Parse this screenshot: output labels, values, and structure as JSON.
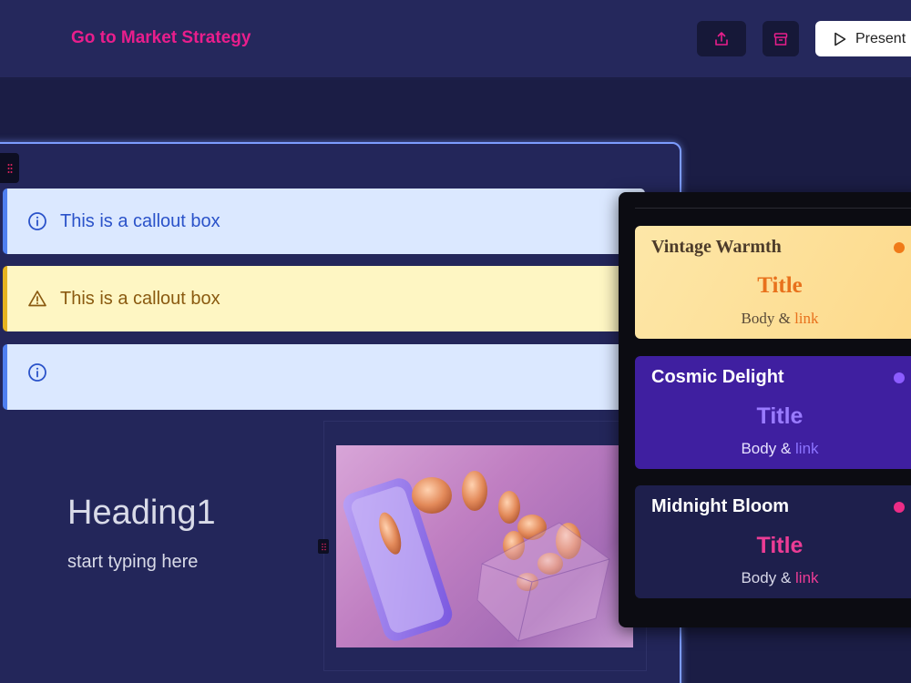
{
  "header": {
    "title": "Go to Market Strategy",
    "present_label": "Present",
    "share_icon": "share-icon",
    "archive_icon": "archive-icon"
  },
  "slide": {
    "callouts": [
      {
        "type": "info",
        "text": "This is a callout box",
        "icon": "info-icon"
      },
      {
        "type": "warning",
        "text": "This is a callout box",
        "icon": "warning-icon"
      },
      {
        "type": "info",
        "text": "",
        "icon": "info-icon"
      }
    ],
    "heading": "Heading1",
    "subtext": "start typing here",
    "image_icon": "coins-phone-image"
  },
  "themes": [
    {
      "name": "Vintage Warmth",
      "title": "Title",
      "body": "Body",
      "amp": "&",
      "link": "link"
    },
    {
      "name": "Cosmic Delight",
      "title": "Title",
      "body": "Body",
      "amp": "&",
      "link": "link"
    },
    {
      "name": "Midnight Bloom",
      "title": "Title",
      "body": "Body",
      "amp": "&",
      "link": "link"
    }
  ],
  "colors": {
    "accent": "#e91e8c",
    "background": "#1c1f4a",
    "header": "#25285c",
    "info": "#dbe8ff",
    "warning": "#fef6c3"
  }
}
